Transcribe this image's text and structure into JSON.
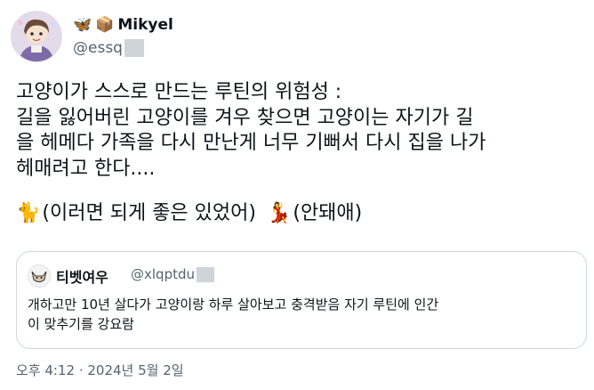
{
  "tweet": {
    "user": {
      "name_emojis": [
        "🦋",
        "📦"
      ],
      "display_name": "Mikyel",
      "handle": "@essq",
      "avatar_icon": "anime-character-avatar-icon"
    },
    "text_lines": [
      "고양이가 스스로 만드는 루틴의 위험성 :",
      "길을 잃어버린 고양이를 겨우 찾으면 고양이는 자기가 길",
      "을 헤메다 가족을 다시 만난게 너무 기뻐서 다시 집을 나가",
      "헤매려고 한다...."
    ],
    "reaction_line": {
      "cat_emoji": "🐈",
      "cat_text": "(이러면 되게 좋은 있었어)",
      "person_emoji": "💃",
      "person_text": "(안돼애)"
    },
    "quote": {
      "display_name": "티벳여우",
      "handle": "@xlqptdu",
      "avatar_icon": "fox-avatar-icon",
      "text_lines": [
        "개하고만 10년 살다가 고양이랑 하루 살아보고 충격받음 자기 루틴에 인간",
        "이 맞추기를 강요람"
      ]
    },
    "timestamp": "오후 4:12 · 2024년 5월 2일"
  }
}
